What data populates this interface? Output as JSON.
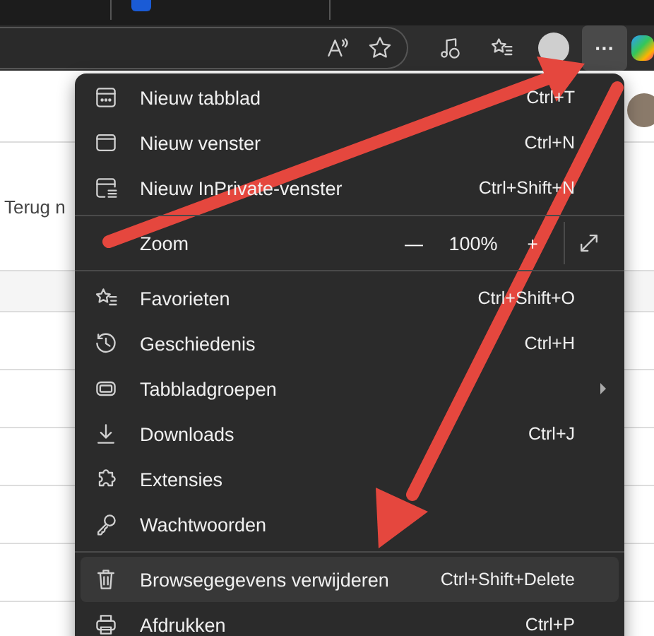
{
  "page": {
    "text": "Terug n"
  },
  "toolbar": {
    "menu_button": {
      "label": "···",
      "selected": true
    }
  },
  "menu": {
    "items": [
      {
        "kind": "item",
        "label": "Nieuw tabblad",
        "shortcut": "Ctrl+T",
        "selected": false
      },
      {
        "kind": "item",
        "label": "Nieuw venster",
        "shortcut": "Ctrl+N",
        "selected": false
      },
      {
        "kind": "item",
        "label": "Nieuw InPrivate-venster",
        "shortcut": "Ctrl+Shift+N",
        "selected": false
      },
      {
        "kind": "divider"
      },
      {
        "kind": "zoom",
        "label": "Zoom",
        "minus": "—",
        "value": "100%",
        "plus": "+"
      },
      {
        "kind": "divider"
      },
      {
        "kind": "item",
        "label": "Favorieten",
        "shortcut": "Ctrl+Shift+O",
        "selected": false
      },
      {
        "kind": "item",
        "label": "Geschiedenis",
        "shortcut": "Ctrl+H",
        "selected": false
      },
      {
        "kind": "submenu",
        "label": "Tabbladgroepen",
        "selected": false
      },
      {
        "kind": "item",
        "label": "Downloads",
        "shortcut": "Ctrl+J",
        "selected": false
      },
      {
        "kind": "item",
        "label": "Extensies",
        "selected": false
      },
      {
        "kind": "item",
        "label": "Wachtwoorden",
        "selected": false
      },
      {
        "kind": "divider"
      },
      {
        "kind": "item",
        "label": "Browsegegevens verwijderen",
        "shortcut": "Ctrl+Shift+Delete",
        "selected": true
      },
      {
        "kind": "item",
        "label": "Afdrukken",
        "shortcut": "Ctrl+P",
        "selected": false
      }
    ]
  }
}
